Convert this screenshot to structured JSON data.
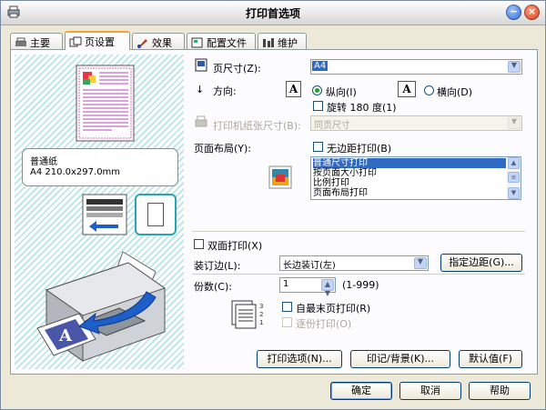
{
  "window": {
    "title": "打印首选项"
  },
  "tabs": [
    {
      "label": "主要",
      "icon": "printer-icon"
    },
    {
      "label": "页设置",
      "icon": "pages-icon"
    },
    {
      "label": "效果",
      "icon": "brush-icon"
    },
    {
      "label": "配置文件",
      "icon": "profile-icon"
    },
    {
      "label": "维护",
      "icon": "tools-icon"
    }
  ],
  "preview": {
    "paper_name": "普通纸",
    "paper_size": "A4 210.0x297.0mm"
  },
  "page_size": {
    "label": "页尺寸(Z):",
    "value": "A4"
  },
  "orientation": {
    "label": "方向:",
    "portrait": "纵向(I)",
    "landscape": "横向(D)",
    "rotate": "旋转 180 度(1)"
  },
  "printer_paper_size": {
    "label": "打印机纸张尺寸(B):",
    "value": "同页尺寸"
  },
  "layout": {
    "label": "页面布局(Y):",
    "borderless": "无边距打印(B)",
    "options": [
      "普通尺寸打印",
      "按页面大小打印",
      "比例打印",
      "页面布局打印"
    ]
  },
  "duplex": {
    "label": "双面打印(X)"
  },
  "binding": {
    "label": "装订边(L):",
    "value": "长边装订(左)",
    "margin_button": "指定边距(G)..."
  },
  "copies": {
    "label": "份数(C):",
    "value": "1",
    "range": "(1-999)",
    "reverse": "自最末页打印(R)",
    "collate": "逐份打印(O)"
  },
  "bottom_buttons": {
    "print_options": "打印选项(N)...",
    "stamp": "印记/背景(K)...",
    "defaults": "默认值(F)"
  },
  "dialog_buttons": {
    "ok": "确定",
    "cancel": "取消",
    "help": "帮助"
  }
}
